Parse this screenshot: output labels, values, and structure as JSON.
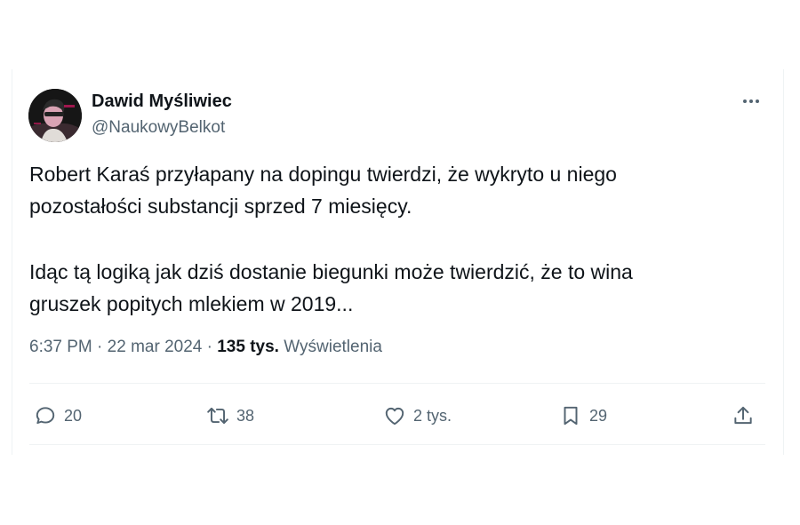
{
  "author": {
    "name": "Dawid Myśliwiec",
    "handle": "@NaukowyBelkot"
  },
  "tweet": {
    "paragraphs": [
      [
        "Robert Karaś przyłapany na dopingu twierdzi, że wykryto u niego",
        "pozostałości substancji sprzed 7 miesięcy."
      ],
      [
        "Idąc tą logiką jak dziś dostanie biegunki może twierdzić, że to wina",
        "gruszek popitych mlekiem w 2019..."
      ]
    ]
  },
  "meta": {
    "time": "6:37 PM",
    "separator": "·",
    "date": "22 mar 2024",
    "views_count": "135 tys.",
    "views_label": "Wyświetlenia"
  },
  "actions": {
    "replies": "20",
    "retweets": "38",
    "likes": "2 tys.",
    "bookmarks": "29"
  },
  "icons": {
    "more": "more-horizontal-icon",
    "reply": "reply-icon",
    "retweet": "retweet-icon",
    "like": "heart-icon",
    "bookmark": "bookmark-icon",
    "share": "share-icon"
  },
  "colors": {
    "text": "#0f1419",
    "secondary": "#536471",
    "divider": "#eff3f4"
  }
}
